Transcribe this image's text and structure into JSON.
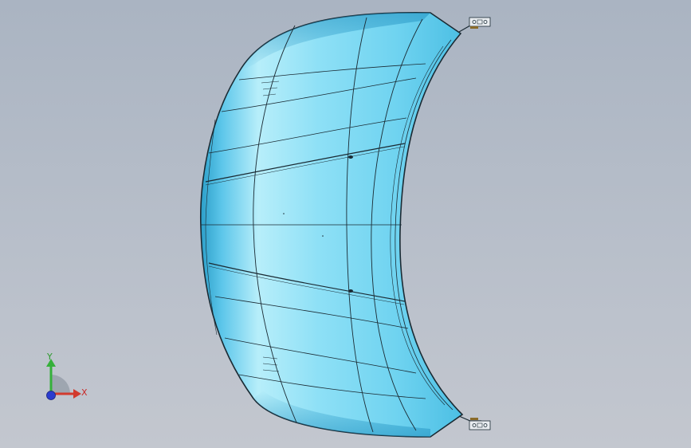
{
  "viewport": {
    "background_top": "#aab4c2",
    "background_bottom": "#c3c7cf"
  },
  "model": {
    "part": "hood-panel",
    "surface_color": "#6fd3f0",
    "edge_color": "#1a2a33",
    "hinge_count": 2
  },
  "triad": {
    "x_label": "X",
    "y_label": "Y",
    "x_color": "#d23a2e",
    "y_color": "#35b03a",
    "z_color": "#2a3ccf"
  }
}
